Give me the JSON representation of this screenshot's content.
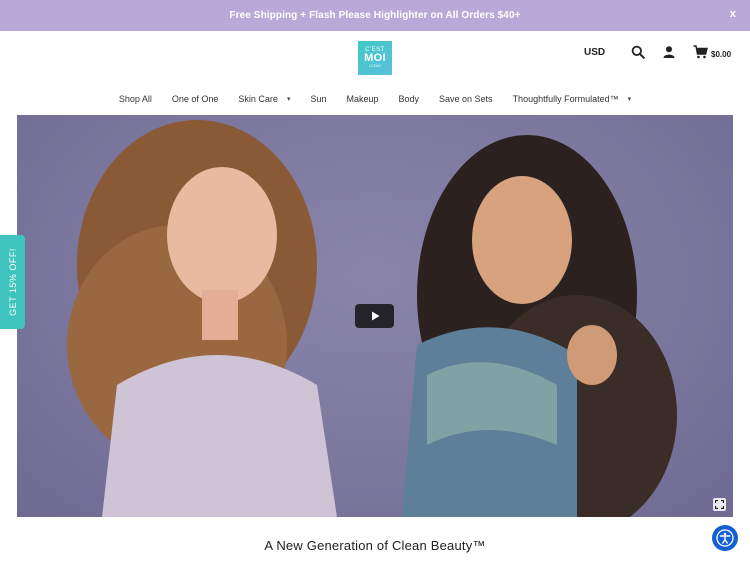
{
  "announcement": {
    "text": "Free Shipping + Flash Please Highlighter on All Orders $40+",
    "close_label": "x"
  },
  "header": {
    "logo": {
      "line1": "C'EST",
      "line2": "MOI",
      "line3": "CLEAN"
    },
    "currency": "USD",
    "cart_total": "$0.00"
  },
  "nav": {
    "items": [
      {
        "label": "Shop All"
      },
      {
        "label": "One of One"
      },
      {
        "label": "Skin Care",
        "dropdown": true
      },
      {
        "label": "Sun"
      },
      {
        "label": "Makeup"
      },
      {
        "label": "Body"
      },
      {
        "label": "Save on Sets"
      },
      {
        "label": "Thoughtfully Formulated™",
        "dropdown": true
      }
    ],
    "caret": "▾"
  },
  "side_tab": {
    "label": "GET 15% OFF!"
  },
  "hero": {
    "headline": "A New Generation of Clean Beauty™"
  },
  "colors": {
    "announcement_bg": "#b9a9d9",
    "side_tab": "#3ec3be",
    "logo": "#3ec9c2",
    "accessibility": "#1560d4"
  },
  "icons": [
    "search-icon",
    "user-icon",
    "cart-icon",
    "play-icon",
    "fullscreen-icon",
    "accessibility-icon"
  ]
}
